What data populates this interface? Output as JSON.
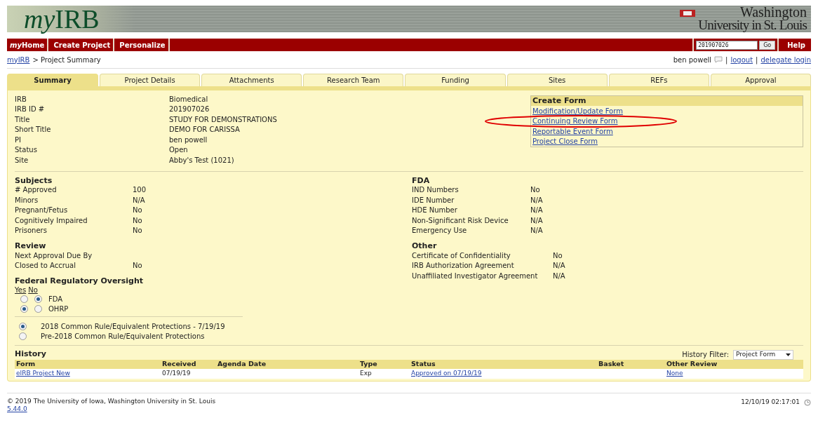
{
  "header": {
    "logo_prefix": "my",
    "logo_name": "IRB",
    "university_line1": "Washington",
    "university_line2": "University in St. Louis"
  },
  "nav": {
    "items": [
      {
        "italic_part": "my",
        "text": "Home"
      },
      {
        "text": "Create Project"
      },
      {
        "text": "Personalize"
      }
    ],
    "search_value": "201907026",
    "go": "Go",
    "help": "Help"
  },
  "breadcrumb": {
    "link": "myIRB",
    "rest": "> Project Summary"
  },
  "user": {
    "name": "ben powell",
    "links": [
      "logout",
      "delegate login"
    ],
    "separator": "|"
  },
  "tabs": [
    {
      "label": "Summary",
      "selected": true
    },
    {
      "label": "Project Details",
      "selected": false
    },
    {
      "label": "Attachments",
      "selected": false
    },
    {
      "label": "Research Team",
      "selected": false
    },
    {
      "label": "Funding",
      "selected": false
    },
    {
      "label": "Sites",
      "selected": false
    },
    {
      "label": "REFs",
      "selected": false
    },
    {
      "label": "Approval",
      "selected": false
    }
  ],
  "summary": [
    {
      "label": "IRB",
      "value": "Biomedical"
    },
    {
      "label": "IRB ID #",
      "value": "201907026"
    },
    {
      "label": "Title",
      "value": "STUDY FOR DEMONSTRATIONS"
    },
    {
      "label": "Short Title",
      "value": "DEMO FOR CARISSA"
    },
    {
      "label": "PI",
      "value": "ben powell"
    },
    {
      "label": "Status",
      "value": "Open"
    },
    {
      "label": "Site",
      "value": "Abby's Test (1021)"
    }
  ],
  "create_form": {
    "title": "Create Form",
    "links": [
      "Modification/Update Form",
      "Continuing Review Form",
      "Reportable Event Form",
      "Project Close Form"
    ]
  },
  "sections_left": [
    {
      "title": "Subjects",
      "rows": [
        {
          "label": "# Approved",
          "value": "100"
        },
        {
          "label": "Minors",
          "value": "N/A"
        },
        {
          "label": "Pregnant/Fetus",
          "value": "No"
        },
        {
          "label": "Cognitively Impaired",
          "value": "No"
        },
        {
          "label": "Prisoners",
          "value": "No"
        }
      ]
    },
    {
      "title": "Review",
      "rows": [
        {
          "label": "Next Approval Due By"
        },
        {
          "label": "Closed to Accrual",
          "value": "No"
        }
      ]
    }
  ],
  "sections_right": [
    {
      "title": "FDA",
      "rows": [
        {
          "label": "IND Numbers",
          "value": "No"
        },
        {
          "label": "IDE Number",
          "value": "N/A"
        },
        {
          "label": "HDE Number",
          "value": "N/A"
        },
        {
          "label": "Non-Significant Risk Device",
          "value": "N/A"
        },
        {
          "label": "Emergency Use",
          "value": "N/A"
        }
      ]
    },
    {
      "title": "Other",
      "rows": [
        {
          "label": "Certificate of Confidentiality",
          "value": "No"
        },
        {
          "label": "IRB Authorization Agreement",
          "value": "N/A"
        },
        {
          "label": "Unaffiliated Investigator Agreement",
          "value": "N/A"
        }
      ]
    }
  ],
  "oversight": {
    "title": "Federal Regulatory Oversight",
    "yes_label": "Yes",
    "no_label": "No",
    "rows": [
      {
        "label": "FDA",
        "yes": false,
        "no": true
      },
      {
        "label": "OHRP",
        "yes": true,
        "no": false
      }
    ]
  },
  "common_rule": [
    {
      "label": "2018 Common Rule/Equivalent Protections - 7/19/19",
      "selected": true
    },
    {
      "label": "Pre-2018 Common Rule/Equivalent Protections",
      "selected": false
    }
  ],
  "history": {
    "title": "History",
    "filter_label": "History Filter:",
    "filter_value": "Project Form",
    "columns": [
      "Form",
      "Received",
      "Agenda Date",
      "Type",
      "Status",
      "Basket",
      "Other Review"
    ],
    "rows": [
      [
        {
          "text": "eIRB Project New",
          "kind": "link"
        },
        {
          "text": "07/19/19",
          "kind": "text"
        },
        {
          "kind": "empty"
        },
        {
          "text": "Exp",
          "kind": "text"
        },
        {
          "text": "Approved on 07/19/19",
          "kind": "link"
        },
        {
          "kind": "empty"
        },
        {
          "text": "None",
          "kind": "link"
        }
      ]
    ]
  },
  "footer": {
    "copyright": "© 2019 The University of Iowa, Washington University in St. Louis",
    "version": "5.44.0",
    "timestamp": "12/10/19 02:17:01"
  }
}
